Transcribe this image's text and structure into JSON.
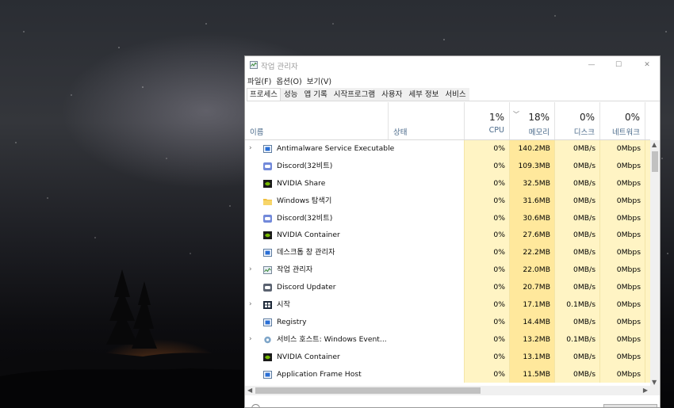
{
  "window": {
    "title": "작업 관리자",
    "controls": {
      "minimize": "—",
      "maximize": "☐",
      "close": "✕"
    }
  },
  "menu": [
    "파일(F)",
    "옵션(O)",
    "보기(V)"
  ],
  "tabs": [
    {
      "label": "프로세스",
      "active": true
    },
    {
      "label": "성능",
      "active": false
    },
    {
      "label": "앱 기록",
      "active": false
    },
    {
      "label": "시작프로그램",
      "active": false
    },
    {
      "label": "사용자",
      "active": false
    },
    {
      "label": "세부 정보",
      "active": false
    },
    {
      "label": "서비스",
      "active": false
    }
  ],
  "columns": {
    "name": "이름",
    "status": "상태",
    "cpu": {
      "percent": "1%",
      "label": "CPU"
    },
    "memory": {
      "percent": "18%",
      "label": "메모리",
      "sort_indicator": "﹀"
    },
    "disk": {
      "percent": "0%",
      "label": "디스크"
    },
    "network": {
      "percent": "0%",
      "label": "네트워크"
    }
  },
  "processes": [
    {
      "name": "Antimalware Service Executable",
      "expandable": true,
      "icon": "service-app-icon",
      "cpu": "0%",
      "memory": "140.2MB",
      "disk": "0MB/s",
      "network": "0Mbps"
    },
    {
      "name": "Discord(32비트)",
      "expandable": false,
      "icon": "discord-icon",
      "cpu": "0%",
      "memory": "109.3MB",
      "disk": "0MB/s",
      "network": "0Mbps"
    },
    {
      "name": "NVIDIA Share",
      "expandable": false,
      "icon": "nvidia-icon",
      "cpu": "0%",
      "memory": "32.5MB",
      "disk": "0MB/s",
      "network": "0Mbps"
    },
    {
      "name": "Windows 탐색기",
      "expandable": false,
      "icon": "folder-icon",
      "cpu": "0%",
      "memory": "31.6MB",
      "disk": "0MB/s",
      "network": "0Mbps"
    },
    {
      "name": "Discord(32비트)",
      "expandable": false,
      "icon": "discord-icon",
      "cpu": "0%",
      "memory": "30.6MB",
      "disk": "0MB/s",
      "network": "0Mbps"
    },
    {
      "name": "NVIDIA Container",
      "expandable": false,
      "icon": "nvidia-icon",
      "cpu": "0%",
      "memory": "27.6MB",
      "disk": "0MB/s",
      "network": "0Mbps"
    },
    {
      "name": "데스크톱 창 관리자",
      "expandable": false,
      "icon": "window-manager-icon",
      "cpu": "0%",
      "memory": "22.2MB",
      "disk": "0MB/s",
      "network": "0Mbps"
    },
    {
      "name": "작업 관리자",
      "expandable": true,
      "icon": "task-manager-icon",
      "cpu": "0%",
      "memory": "22.0MB",
      "disk": "0MB/s",
      "network": "0Mbps"
    },
    {
      "name": "Discord Updater",
      "expandable": false,
      "icon": "discord-updater-icon",
      "cpu": "0%",
      "memory": "20.7MB",
      "disk": "0MB/s",
      "network": "0Mbps"
    },
    {
      "name": "시작",
      "expandable": true,
      "icon": "start-icon",
      "cpu": "0%",
      "memory": "17.1MB",
      "disk": "0.1MB/s",
      "network": "0Mbps"
    },
    {
      "name": "Registry",
      "expandable": false,
      "icon": "registry-icon",
      "cpu": "0%",
      "memory": "14.4MB",
      "disk": "0MB/s",
      "network": "0Mbps"
    },
    {
      "name": "서비스 호스트: Windows Event...",
      "expandable": true,
      "icon": "gear-icon",
      "cpu": "0%",
      "memory": "13.2MB",
      "disk": "0.1MB/s",
      "network": "0Mbps"
    },
    {
      "name": "NVIDIA Container",
      "expandable": false,
      "icon": "nvidia-icon",
      "cpu": "0%",
      "memory": "13.1MB",
      "disk": "0MB/s",
      "network": "0Mbps"
    },
    {
      "name": "Application Frame Host",
      "expandable": false,
      "icon": "app-frame-icon",
      "cpu": "0%",
      "memory": "11.5MB",
      "disk": "0MB/s",
      "network": "0Mbps"
    }
  ],
  "colors": {
    "cell_light": "#fff4c4",
    "cell_memory": "#ffe89c",
    "header_label": "#4a6a8a"
  }
}
